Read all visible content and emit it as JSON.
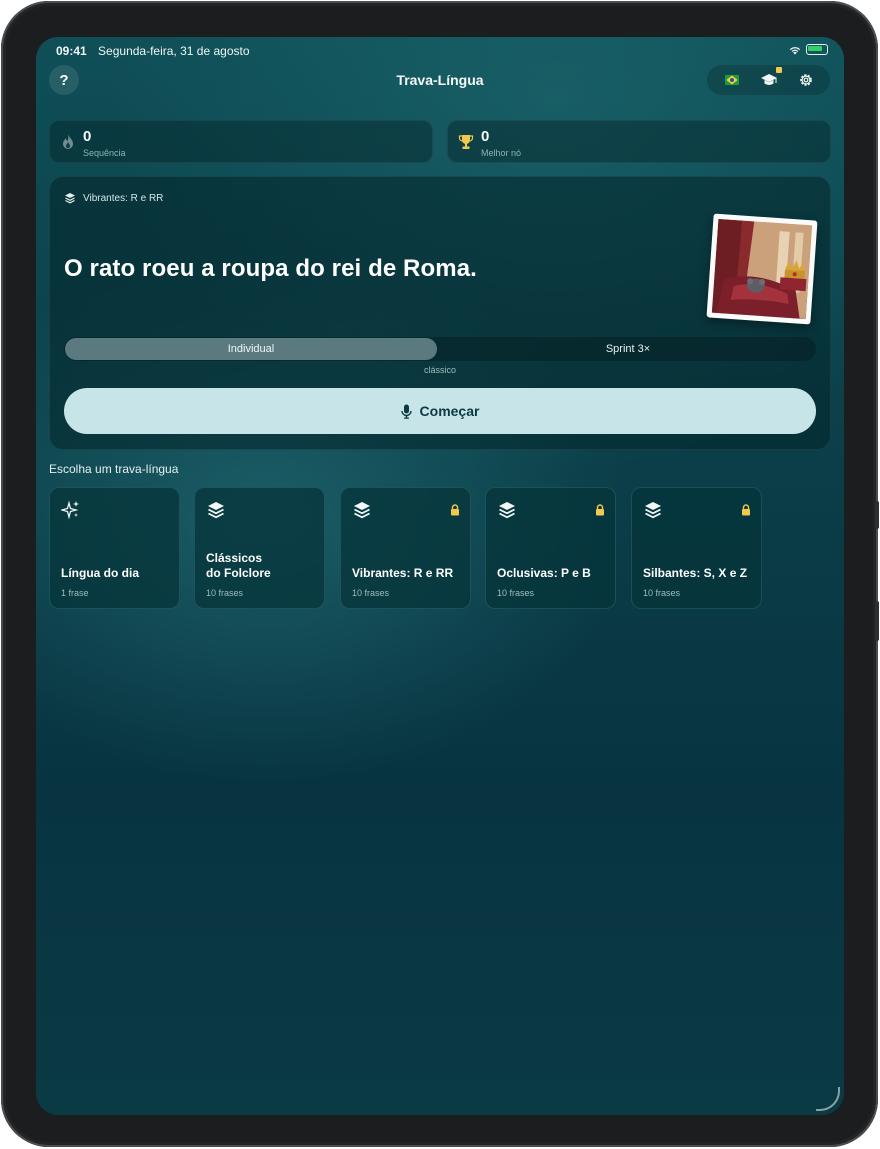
{
  "status_bar": {
    "time": "09:41",
    "date": "Segunda-feira, 31 de agosto"
  },
  "header": {
    "help_label": "?",
    "title": "Trava-Língua"
  },
  "stats": {
    "streak": {
      "value": "0",
      "label": "Sequência"
    },
    "best": {
      "value": "0",
      "label": "Melhor nó"
    }
  },
  "current": {
    "category": "Vibrantes: R e RR",
    "phrase": "O rato roeu a roupa do rei de Roma.",
    "modes": [
      "Individual",
      "Sprint 3×"
    ],
    "selected_mode": "Individual",
    "mode_caption": "clássico",
    "start_label": "Começar"
  },
  "picker": {
    "title": "Escolha um trava-língua",
    "items": [
      {
        "name": "Língua do dia",
        "count": "1 frase",
        "icon": "sparkles-icon",
        "locked": false
      },
      {
        "name": "Clássicos\ndo Folclore",
        "count": "10 frases",
        "icon": "stack-icon",
        "locked": false
      },
      {
        "name": "Vibrantes: R e RR",
        "count": "10 frases",
        "icon": "stack-icon",
        "locked": true
      },
      {
        "name": "Oclusivas: P e B",
        "count": "10 frases",
        "icon": "stack-icon",
        "locked": true
      },
      {
        "name": "Silbantes: S, X e Z",
        "count": "10 frases",
        "icon": "stack-icon",
        "locked": true
      }
    ]
  },
  "colors": {
    "accent_button": "#c7e4e8",
    "lock": "#f2c94c",
    "trophy": "#f2c94c",
    "background": "#0b3e48"
  }
}
